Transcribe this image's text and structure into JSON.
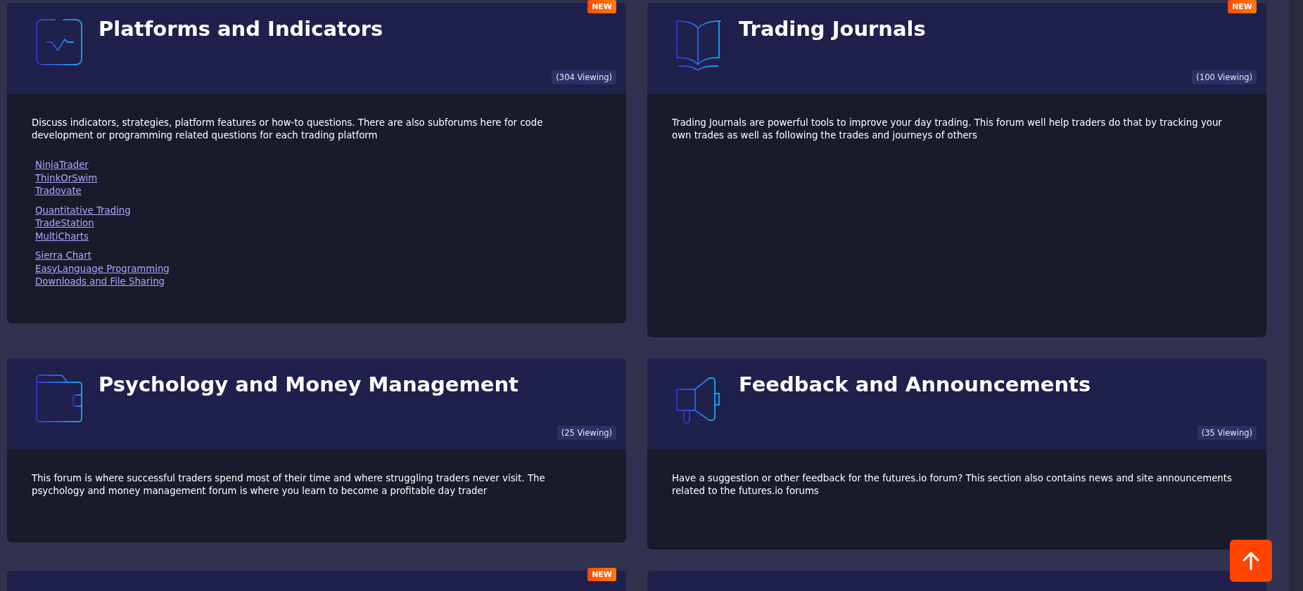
{
  "forums": [
    {
      "title": "Platforms and Indicators",
      "kind": "pulse",
      "badge": "NEW",
      "viewing": "(304 Viewing)",
      "description": "Discuss indicators, strategies, platform features or how-to questions. There are also subforums here for code development or programming related questions for each trading platform",
      "link_groups": [
        [
          "NinjaTrader",
          "ThinkOrSwim",
          "Tradovate"
        ],
        [
          "Quantitative Trading",
          "TradeStation",
          "MultiCharts"
        ],
        [
          "Sierra Chart",
          "EasyLanguage Programming",
          "Downloads and File Sharing"
        ]
      ]
    },
    {
      "title": "Trading Journals",
      "kind": "book",
      "badge": "NEW",
      "viewing": "(100 Viewing)",
      "description": "Trading Journals are powerful tools to improve your day trading. This forum well help traders do that by tracking your own trades as well as following the trades and journeys of others"
    },
    {
      "title": "Psychology and Money Management",
      "kind": "wallet",
      "viewing": "(25 Viewing)",
      "description": "This forum is where successful traders spend most of their time and where struggling traders never visit. The psychology and money management forum is where you learn to become a profitable day trader"
    },
    {
      "title": "Feedback and Announcements",
      "kind": "megaphone",
      "viewing": "(35 Viewing)",
      "description": "Have a suggestion or other feedback for the futures.io forum? This section also contains news and site announcements related to the futures.io forums"
    },
    {
      "kind": "partial",
      "badge": "NEW"
    },
    {
      "kind": "partial"
    }
  ]
}
